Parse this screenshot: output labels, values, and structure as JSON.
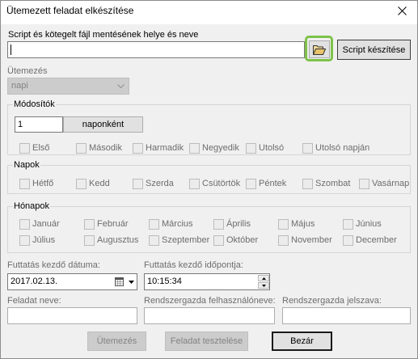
{
  "window": {
    "title": "Ütemezett feladat elkészítése",
    "close_icon": "close-icon"
  },
  "script": {
    "label": "Script és kötegelt fájl mentésének helye és neve",
    "path_value": "",
    "browse_icon": "folder-open-icon",
    "create_button": "Script készítése"
  },
  "schedule": {
    "label": "Ütemezés",
    "selected": "napi",
    "enabled": false,
    "dropdown_icon": "chevron-down-icon"
  },
  "modifiers": {
    "group_label": "Módosítók",
    "interval_value": "1",
    "interval_unit": "naponként",
    "checkboxes": [
      {
        "label": "Első",
        "checked": false
      },
      {
        "label": "Második",
        "checked": false
      },
      {
        "label": "Harmadik",
        "checked": false
      },
      {
        "label": "Negyedik",
        "checked": false
      },
      {
        "label": "Utolsó",
        "checked": false
      },
      {
        "label": "Utolsó napján",
        "checked": false
      }
    ]
  },
  "days": {
    "group_label": "Napok",
    "checkboxes": [
      {
        "label": "Hétfő",
        "checked": false
      },
      {
        "label": "Kedd",
        "checked": false
      },
      {
        "label": "Szerda",
        "checked": false
      },
      {
        "label": "Csütörtök",
        "checked": false
      },
      {
        "label": "Péntek",
        "checked": false
      },
      {
        "label": "Szombat",
        "checked": false
      },
      {
        "label": "Vasárnap",
        "checked": false
      }
    ]
  },
  "months": {
    "group_label": "Hónapok",
    "checkboxes": [
      {
        "label": "Január",
        "checked": false
      },
      {
        "label": "Február",
        "checked": false
      },
      {
        "label": "Március",
        "checked": false
      },
      {
        "label": "Április",
        "checked": false
      },
      {
        "label": "Május",
        "checked": false
      },
      {
        "label": "Június",
        "checked": false
      },
      {
        "label": "Július",
        "checked": false
      },
      {
        "label": "Augusztus",
        "checked": false
      },
      {
        "label": "Szeptember",
        "checked": false
      },
      {
        "label": "Október",
        "checked": false
      },
      {
        "label": "November",
        "checked": false
      },
      {
        "label": "December",
        "checked": false
      }
    ]
  },
  "start_date": {
    "label": "Futtatás kezdő dátuma:",
    "value": "2017.02.13.",
    "calendar_icon": "calendar-icon"
  },
  "start_time": {
    "label": "Futtatás kezdő időpontja:",
    "value": "10:15:34"
  },
  "task_name": {
    "label": "Feladat neve:",
    "value": ""
  },
  "admin_username": {
    "label": "Rendszergazda felhasználóneve:",
    "value": ""
  },
  "admin_password": {
    "label": "Rendszergazda jelszava:",
    "value": ""
  },
  "footer": {
    "schedule_button": "Ütemezés",
    "test_button": "Feladat tesztelése",
    "close_button": "Bezár"
  },
  "colors": {
    "dialog_bg": "#f0f0f0",
    "title_bg": "#ffffff",
    "highlight": "#7ec24a",
    "disabled_text": "#6d6d6d",
    "group_border": "#d5d5d5"
  }
}
